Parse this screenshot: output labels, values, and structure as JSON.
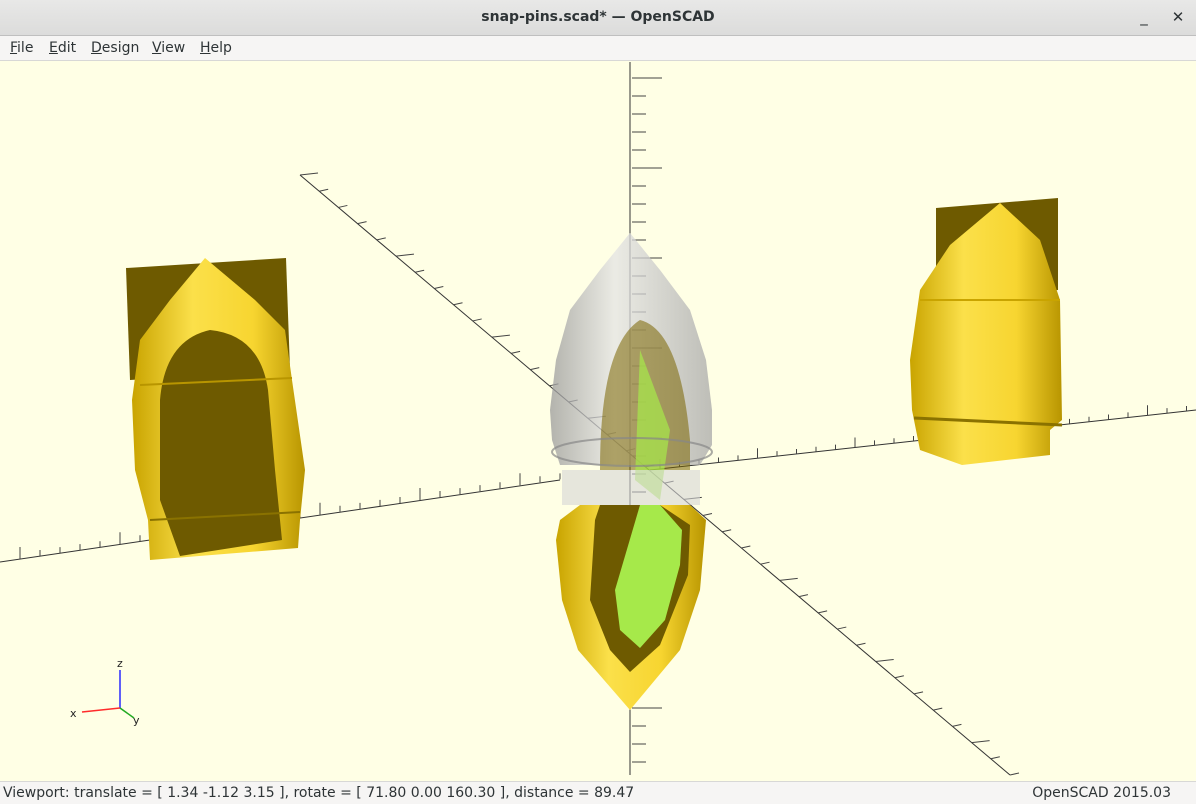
{
  "window": {
    "title": "snap-pins.scad* — OpenSCAD",
    "minimize_glyph": "_",
    "close_glyph": "✕"
  },
  "menu": {
    "items": [
      {
        "label": "File"
      },
      {
        "label": "Edit"
      },
      {
        "label": "Design"
      },
      {
        "label": "View"
      },
      {
        "label": "Help"
      }
    ]
  },
  "viewport": {
    "background_color": "#ffffe5",
    "model_color": "#f9d72c",
    "section_color": "#6e5a00",
    "highlight_color": "#a6e94a",
    "ghost_color": "#c8c8c8",
    "axes_gizmo": {
      "x_label": "x",
      "y_label": "y",
      "z_label": "z"
    }
  },
  "status": {
    "viewport_text": "Viewport: translate = [ 1.34 -1.12 3.15 ], rotate = [ 71.80 0.00 160.30 ], distance = 89.47",
    "version_text": "OpenSCAD 2015.03"
  }
}
